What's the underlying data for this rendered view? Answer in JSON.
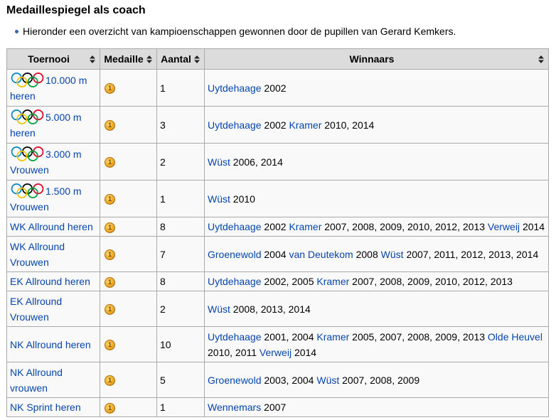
{
  "section": {
    "title": "Medaillespiegel als coach",
    "bullet_icon": "bullet-icon",
    "intro": "Hieronder een overzicht van kampioenschappen gewonnen door de pupillen van Gerard Kemkers."
  },
  "table": {
    "sort_icon": "sort-arrows-icon",
    "headers": {
      "toernooi": "Toernooi",
      "medaille": "Medaille",
      "aantal": "Aantal",
      "winnaars": "Winnaars"
    },
    "rows": [
      {
        "toernooi": "10.000 m heren",
        "toernooi_icon": "olympic-rings-icon",
        "medaille_icon": "gold-medal-icon",
        "medaille_rank": "1",
        "aantal": "1",
        "winnaars": [
          {
            "name": "Uytdehaage",
            "years": "2002"
          }
        ]
      },
      {
        "toernooi": "5.000 m heren",
        "toernooi_icon": "olympic-rings-icon",
        "medaille_icon": "gold-medal-icon",
        "medaille_rank": "1",
        "aantal": "3",
        "winnaars": [
          {
            "name": "Uytdehaage",
            "years": "2002"
          },
          {
            "name": "Kramer",
            "years": "2010, 2014"
          }
        ]
      },
      {
        "toernooi": "3.000 m Vrouwen",
        "toernooi_icon": "olympic-rings-icon",
        "medaille_icon": "gold-medal-icon",
        "medaille_rank": "1",
        "aantal": "2",
        "winnaars": [
          {
            "name": "Wüst",
            "years": "2006, 2014"
          }
        ]
      },
      {
        "toernooi": "1.500 m Vrouwen",
        "toernooi_icon": "olympic-rings-icon",
        "medaille_icon": "gold-medal-icon",
        "medaille_rank": "1",
        "aantal": "1",
        "winnaars": [
          {
            "name": "Wüst",
            "years": "2010"
          }
        ]
      },
      {
        "toernooi": "WK Allround heren",
        "medaille_icon": "gold-medal-icon",
        "medaille_rank": "1",
        "aantal": "8",
        "winnaars": [
          {
            "name": "Uytdehaage",
            "years": "2002"
          },
          {
            "name": "Kramer",
            "years": "2007, 2008, 2009, 2010, 2012, 2013"
          },
          {
            "name": "Verweij",
            "years": "2014"
          }
        ]
      },
      {
        "toernooi": "WK Allround Vrouwen",
        "medaille_icon": "gold-medal-icon",
        "medaille_rank": "1",
        "aantal": "7",
        "winnaars": [
          {
            "name": "Groenewold",
            "years": "2004"
          },
          {
            "name": "van Deutekom",
            "years": "2008"
          },
          {
            "name": "Wüst",
            "years": "2007, 2011, 2012, 2013, 2014"
          }
        ]
      },
      {
        "toernooi": "EK Allround heren",
        "medaille_icon": "gold-medal-icon",
        "medaille_rank": "1",
        "aantal": "8",
        "winnaars": [
          {
            "name": "Uytdehaage",
            "years": "2002, 2005"
          },
          {
            "name": "Kramer",
            "years": "2007, 2008, 2009, 2010, 2012, 2013"
          }
        ]
      },
      {
        "toernooi": "EK Allround Vrouwen",
        "medaille_icon": "gold-medal-icon",
        "medaille_rank": "1",
        "aantal": "2",
        "winnaars": [
          {
            "name": "Wüst",
            "years": "2008, 2013, 2014"
          }
        ]
      },
      {
        "toernooi": "NK Allround heren",
        "medaille_icon": "gold-medal-icon",
        "medaille_rank": "1",
        "aantal": "10",
        "winnaars": [
          {
            "name": "Uytdehaage",
            "years": "2001, 2004"
          },
          {
            "name": "Kramer",
            "years": "2005, 2007, 2008, 2009, 2013"
          },
          {
            "name": "Olde Heuvel",
            "years": "2010, 2011"
          },
          {
            "name": "Verweij",
            "years": "2014"
          }
        ]
      },
      {
        "toernooi": "NK Allround vrouwen",
        "medaille_icon": "gold-medal-icon",
        "medaille_rank": "1",
        "aantal": "5",
        "winnaars": [
          {
            "name": "Groenewold",
            "years": "2003, 2004"
          },
          {
            "name": "Wüst",
            "years": "2007, 2008, 2009"
          }
        ]
      },
      {
        "toernooi": "NK Sprint heren",
        "medaille_icon": "gold-medal-icon",
        "medaille_rank": "1",
        "aantal": "1",
        "winnaars": [
          {
            "name": "Wennemars",
            "years": "2007"
          }
        ]
      }
    ]
  },
  "colors": {
    "link": "#0645ad",
    "text": "#000000",
    "header_background": "#dcdcdc",
    "cell_background": "#f9f9f9",
    "border": "#aaaaaa",
    "medal_gold": "#eaa624"
  }
}
